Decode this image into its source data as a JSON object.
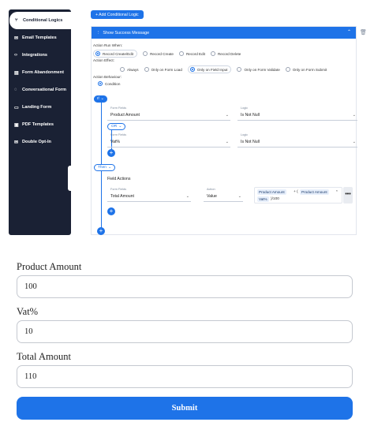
{
  "sidebar": {
    "items": [
      {
        "label": "Conditional Logics",
        "icon": "branch-icon"
      },
      {
        "label": "Email Templates",
        "icon": "envelope-icon"
      },
      {
        "label": "Integrations",
        "icon": "code-icon"
      },
      {
        "label": "Form Abandonment",
        "icon": "form-icon"
      },
      {
        "label": "Conversational Form",
        "icon": "chat-icon"
      },
      {
        "label": "Landing Form",
        "icon": "page-icon"
      },
      {
        "label": "PDF Templates",
        "icon": "pdf-icon"
      },
      {
        "label": "Double Opt-In",
        "icon": "mail-check-icon"
      }
    ]
  },
  "main": {
    "add_button": "+ Add Conditional Logic",
    "card_title": "Show Success Message",
    "action_run_when": {
      "label": "Action Run When:",
      "options": [
        "Record Create/Edit",
        "Record Create",
        "Record Edit",
        "Record Delete"
      ],
      "selected": "Record Create/Edit"
    },
    "action_effect": {
      "label": "Action Effect:",
      "options": [
        "Always",
        "Only on Form Load",
        "Only on Field Input",
        "Only on Form Validate",
        "Only on Form Submit"
      ],
      "selected": "Only on Field Input"
    },
    "action_behaviour": {
      "label": "Action Behaviour:",
      "options": [
        "Condition"
      ],
      "selected": "Condition"
    },
    "if_tag": "If",
    "or_tag": "OR",
    "then_tag": "Then",
    "conditions": [
      {
        "field_caption": "Form Fields",
        "field": "Product Amount",
        "logic_caption": "Logic",
        "logic": "Is Not Null"
      },
      {
        "field_caption": "Form Fields",
        "field": "Vat%",
        "logic_caption": "Logic",
        "logic": "Is Not Null"
      }
    ],
    "field_actions": {
      "title": "Field Actions",
      "field_caption": "Form Fields",
      "field": "Total Amount",
      "action_caption": "Action",
      "action": "Value",
      "expression": {
        "chip1": "Product Amount",
        "op1": "+ (",
        "chip2": "Product Amount",
        "op2": "*",
        "chip3": "Vat%",
        "op3": ")/100"
      }
    }
  },
  "form": {
    "fields": [
      {
        "label": "Product Amount",
        "value": "100"
      },
      {
        "label": "Vat%",
        "value": "10"
      },
      {
        "label": "Total Amount",
        "value": "110"
      }
    ],
    "submit_label": "Submit"
  },
  "colors": {
    "primary": "#1e73e8",
    "sidebar": "#1a2134"
  }
}
